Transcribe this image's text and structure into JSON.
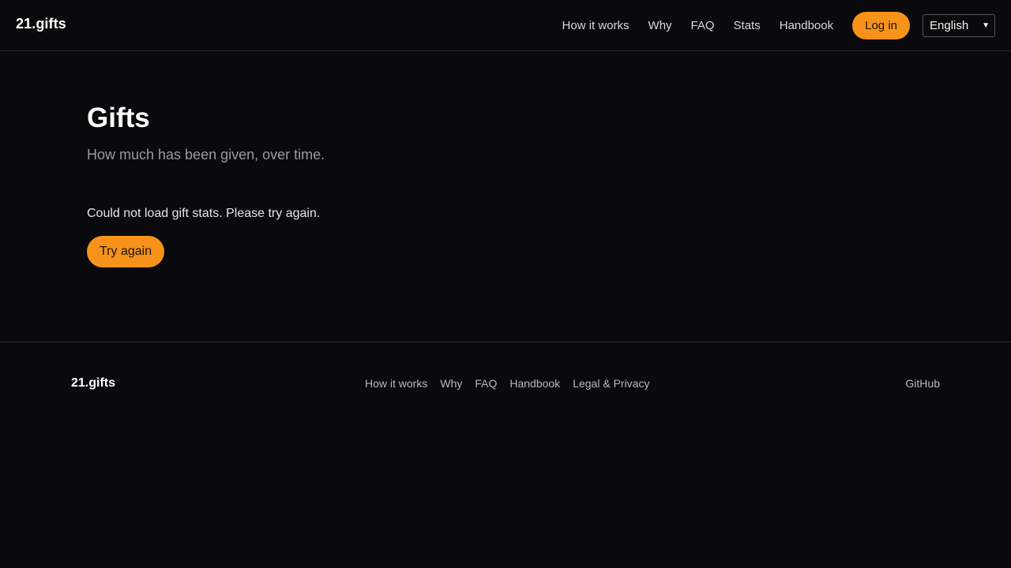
{
  "header": {
    "brand": "21.gifts",
    "nav": [
      {
        "label": "How it works"
      },
      {
        "label": "Why"
      },
      {
        "label": "FAQ"
      },
      {
        "label": "Stats"
      },
      {
        "label": "Handbook"
      }
    ],
    "login_label": "Log in",
    "language": "English"
  },
  "main": {
    "title": "Gifts",
    "subtitle": "How much has been given, over time.",
    "error_message": "Could not load gift stats. Please try again.",
    "retry_label": "Try again"
  },
  "footer": {
    "brand": "21.gifts",
    "links": [
      {
        "label": "How it works"
      },
      {
        "label": "Why"
      },
      {
        "label": "FAQ"
      },
      {
        "label": "Handbook"
      },
      {
        "label": "Legal & Privacy"
      }
    ],
    "github_label": "GitHub"
  },
  "colors": {
    "background": "#0a0a0c",
    "accent": "#f7931a",
    "border": "#2a2a2e"
  }
}
